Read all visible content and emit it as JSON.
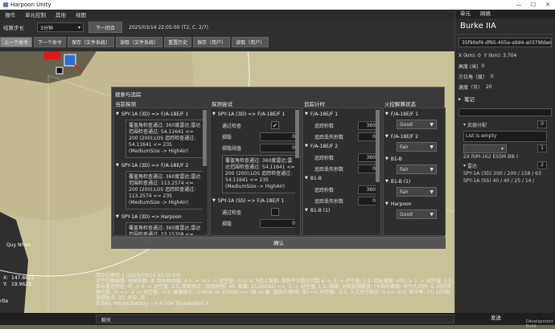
{
  "window": {
    "title": "Harpoon Unity",
    "min": "—",
    "max": "☐",
    "close": "✕"
  },
  "menu": [
    "操作",
    "单元控制",
    "其他",
    "视图"
  ],
  "toolbar": {
    "step_label": "结算步长",
    "step_value": "3分钟",
    "next_round": "下一回合",
    "time_text": "2025/03/14 22:05:00 (T2, C. 2/7)",
    "buttons": [
      "上一个命令",
      "下一个命令",
      "保存（文件系统）",
      "读取（文件系统）",
      "重置历史",
      "保存（用户）",
      "读取（用户）"
    ]
  },
  "right_panel": {
    "tabs": [
      "单元",
      "网络"
    ],
    "unit_name": "Burke IIA",
    "guid": "35f90ef4-df65-405e-a9d4-a0379bbe00",
    "x_label": "X (km):",
    "x_value": "0",
    "y_label": "Y (km):",
    "y_value": "3.704",
    "alt_label": "高度 (米)",
    "alt_value": "0",
    "heading_label": "方位角（度）",
    "heading_value": "0",
    "speed_label": "速度（节）",
    "speed_value": "20",
    "notes_label": "笔记",
    "weapon_alloc_label": "武器分配",
    "weapon_alloc_value": "0",
    "list_empty": "List is empty",
    "missile_name": "2X  RIM-162 ESSM Blk I",
    "missile_count": "1",
    "radar_label": "雷达",
    "radar_count": "2",
    "radar_rows": [
      "SPY-1A (3D)  200  /  200  /  158  /  63",
      "SPY-1A (SS)  40  /  40  /  25  /  14  /"
    ]
  },
  "dialog": {
    "title": "搜索与追踪",
    "confirm": "确认",
    "col1": {
      "header": "当前探测",
      "groups": [
        {
          "label": "SPY-1A (3D) => F/A-18E/F 1",
          "note": "覆盖角检查通过: 360度雷达;雷达范围检查通过: 54.11641 <= 200 (200);LOS 追踪检查通过: 54.11641 <= 235 (MediumSize -> HighAir)"
        },
        {
          "label": "SPY-1A (3D) => F/A-18E/F 2",
          "note": "覆盖角检查通过: 360度雷达;雷达范围检查通过: 113.2574 <= 200 (200);LOS 追踪检查通过: 113.2574 <= 235 (MediumSize -> HighAir)"
        },
        {
          "label": "SPY-1A (3D) => Harpoon",
          "note": "覆盖角检查通过: 360度雷达;雷达范围检查通过: 23.15708 <="
        }
      ]
    },
    "col2": {
      "header": "探测尝试",
      "group1": "SPY-1A (3D) => F/A-18E/F 1",
      "pass_check": "通过检查",
      "dice": "掷骰",
      "dice_value": "0",
      "dice_threshold": "掷骰阈值",
      "dice_threshold_value": "0",
      "note": "覆盖角检查通过: 360度雷达;雷达范围检查通过: 54.11641 <= 200 (200);LOS 追踪检查通过: 54.11641 <= 235 (MediumSize -> HighAir)",
      "group2": "SPY-1A (SS) => F/A-18E/F 1",
      "pass_check2": "通过检查",
      "dice2": "掷骰",
      "dice2_value": "0"
    },
    "col3": {
      "header": "追踪计时",
      "groups": [
        {
          "label": "F/A-18E/F 1",
          "tracked_label": "追踪秒数",
          "tracked": "360",
          "lost_label": "追踪丢失秒数",
          "lost": "0"
        },
        {
          "label": "F/A-18E/F 2",
          "tracked_label": "追踪秒数",
          "tracked": "360",
          "lost_label": "追踪丢失秒数",
          "lost": "0"
        },
        {
          "label": "B1-B",
          "tracked_label": "追踪秒数",
          "tracked": "360",
          "lost_label": "追踪丢失秒数",
          "lost": "0"
        }
      ],
      "cutoff": "B1-B (1)"
    },
    "col4": {
      "header": "火控解算状态",
      "items": [
        {
          "label": "F/A-18E/F 1",
          "value": "Good"
        },
        {
          "label": "F/A-18E/F 2",
          "value": "Fair"
        },
        {
          "label": "B1-B",
          "value": "Fair"
        },
        {
          "label": "B1-B (1)",
          "value": "Fair"
        },
        {
          "label": "Harpoon",
          "value": "Good"
        }
      ]
    }
  },
  "log": [
    "回合切换到 2 (2025/03/14 22:05:00)",
    "对空防御结算: 导弹防御: 4( 目标机动值: 4.5 -> -4.5 -> 对空值: -0.5; 从飞机上发射; 发射平台雷达代数 6 -> 3 -> 对空值: 2.5; 目标速度: 400 -> 1 -> 对空值: 3.5; 目标雷达特征: 中 -> 0 -> 对空值: 3.5; 距离修正: (武器射程: 44, 距离: 25.26091) => -2 -> 对空值: 1.5; 掷骰: 对机损掷骰值: (卡损马表现: 导引头识别: 4, 对抗措施代数: 3) => -2 -> 对空值: -0.5; 高度修正: (10000 vs 10000) => (高 vs 高, 急跃升/俯冲: 否) => 对空值: -0.5; 人工对空修正: 0 => -0.5; 命中率: 25; 100面骰掷骰点: 37; 命中: 否",
    "折目标: Patriot Battery --> A-10A Thunderbolt II"
  ],
  "map": {
    "place_label": "Quy Nhon",
    "coord_x_label": "X:",
    "coord_x": "147.8822",
    "coord_y_label": "Y:",
    "coord_y": "19.9623",
    "side_label": "rtle"
  },
  "status": {
    "chat_label": "聊天",
    "send_label": "发送",
    "build_label": "Development Build"
  },
  "colors": {
    "map_bg": "#c9c299",
    "panel": "#2d2d2d",
    "dialog": "#3a3a3a",
    "accent_red": "#e01818",
    "accent_blue": "#2e6fd0"
  }
}
